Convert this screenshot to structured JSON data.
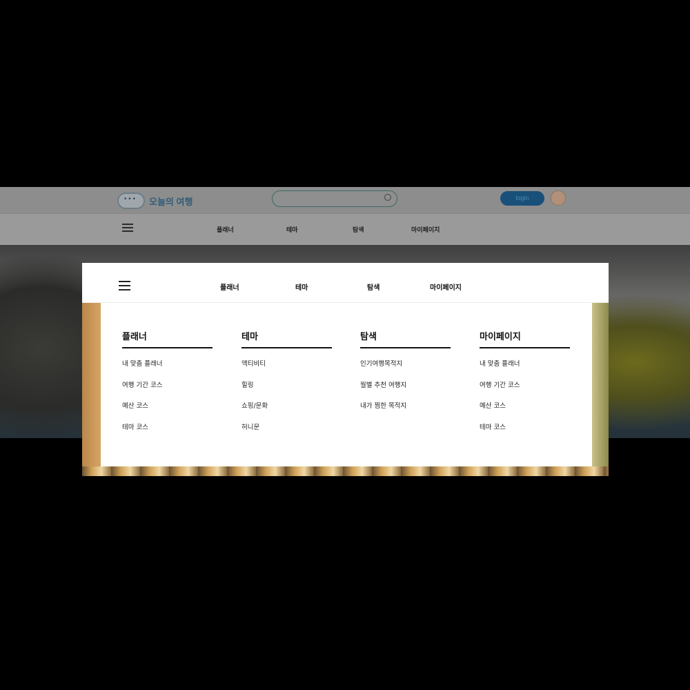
{
  "background_page": {
    "logo_text": "오늘의 여행",
    "search": {
      "placeholder": ""
    },
    "login_label": "login",
    "nav": [
      "플래너",
      "테마",
      "탐색",
      "마이페이지"
    ]
  },
  "overlay": {
    "nav": [
      "플래너",
      "테마",
      "탐색",
      "마이페이지"
    ],
    "columns": [
      {
        "title": "플래너",
        "items": [
          "내 맞춤 플래너",
          "여행 기간 코스",
          "예산 코스",
          "테마 코스"
        ]
      },
      {
        "title": "테마",
        "items": [
          "액티비티",
          "힐링",
          "쇼핑/문화",
          "허니문"
        ]
      },
      {
        "title": "탐색",
        "items": [
          "인기여행목적지",
          "월별 추천 여행지",
          "내가 찜한 목적지"
        ]
      },
      {
        "title": "마이페이지",
        "items": [
          "내 맞춤 플래너",
          "여행 기간 코스",
          "예산 코스",
          "테마 코스"
        ]
      }
    ]
  },
  "colors": {
    "accent": "#19507a",
    "text": "#111111"
  },
  "icons": [
    "logo-cloud-icon",
    "search-icon",
    "avatar",
    "hamburger-menu-icon"
  ]
}
